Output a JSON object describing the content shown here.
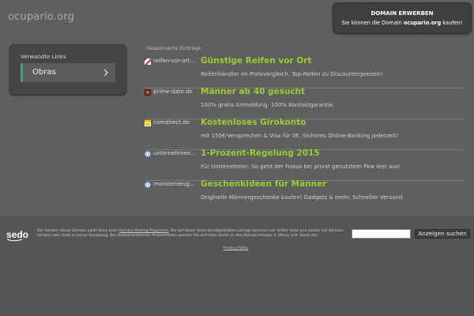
{
  "header": {
    "domain_title": "ocupario.org",
    "buy_title": "DOMAIN ERWERBEN",
    "buy_sub_prefix": "Sie können die Domain ",
    "buy_sub_domain": "ocupario.org",
    "buy_sub_suffix": " kaufen!"
  },
  "related": {
    "title": "Verwandte Links",
    "links": [
      {
        "label": "Obras"
      }
    ],
    "accent_color": "#3fa37a"
  },
  "sponsored": {
    "title": "Gesponserte Einträge",
    "headline_color": "#9acd32",
    "ads": [
      {
        "icon": "tire-favicon",
        "domain": "reifen-vor-ort...",
        "headline": "Günstige Reifen vor Ort",
        "description": "Reifenhändler im Preisvergleich. Top-Reifen zu Discounterpreisen!"
      },
      {
        "icon": "prime-date-favicon",
        "domain": "prime-date.de",
        "headline": "Männer ab 40 gesucht",
        "description": "100% gratis Anmeldung. 100% Kontaktgarantie."
      },
      {
        "icon": "comdirect-favicon",
        "domain": "comdirect.de",
        "headline": "Kostenloses Girokonto",
        "description": "mit 150€-Versprechen & Visa für 0€. Sicheres Online-Banking jederzeit!"
      },
      {
        "icon": "globe-favicon",
        "domain": "unternehmen...",
        "headline": "1-Prozent-Regelung 2015",
        "description": "Für Unternehmer: So geht der Fiskus bei privat genutztem Pkw leer aus!"
      },
      {
        "icon": "globe-favicon",
        "domain": "monsterzeug...",
        "headline": "Geschenkideen für Männer",
        "description": "Originelle Männergeschenke kaufen! Gadgets & mehr. Schneller Versand."
      }
    ]
  },
  "footer": {
    "logo_text": "sedo",
    "disclaimer_1": "Der Inhaber dieser Domain parkt diese beim ",
    "disclaimer_link": "Domain-Parking-Programm",
    "disclaimer_2": ". Die auf dieser Seite bereitgestellten Listings kommen von dritter Seite und stehen mit Domain-Inhaber oder Sedo in keiner Beziehung. Bei markenrechtlichen Problemfällen wenden Sie sich bitte direkt an den Domain-Inhaber ll. Whois (z.B. Denic.de).",
    "search_placeholder": "",
    "search_button": "Anzeigen suchen",
    "privacy": "Privacy Policy"
  }
}
